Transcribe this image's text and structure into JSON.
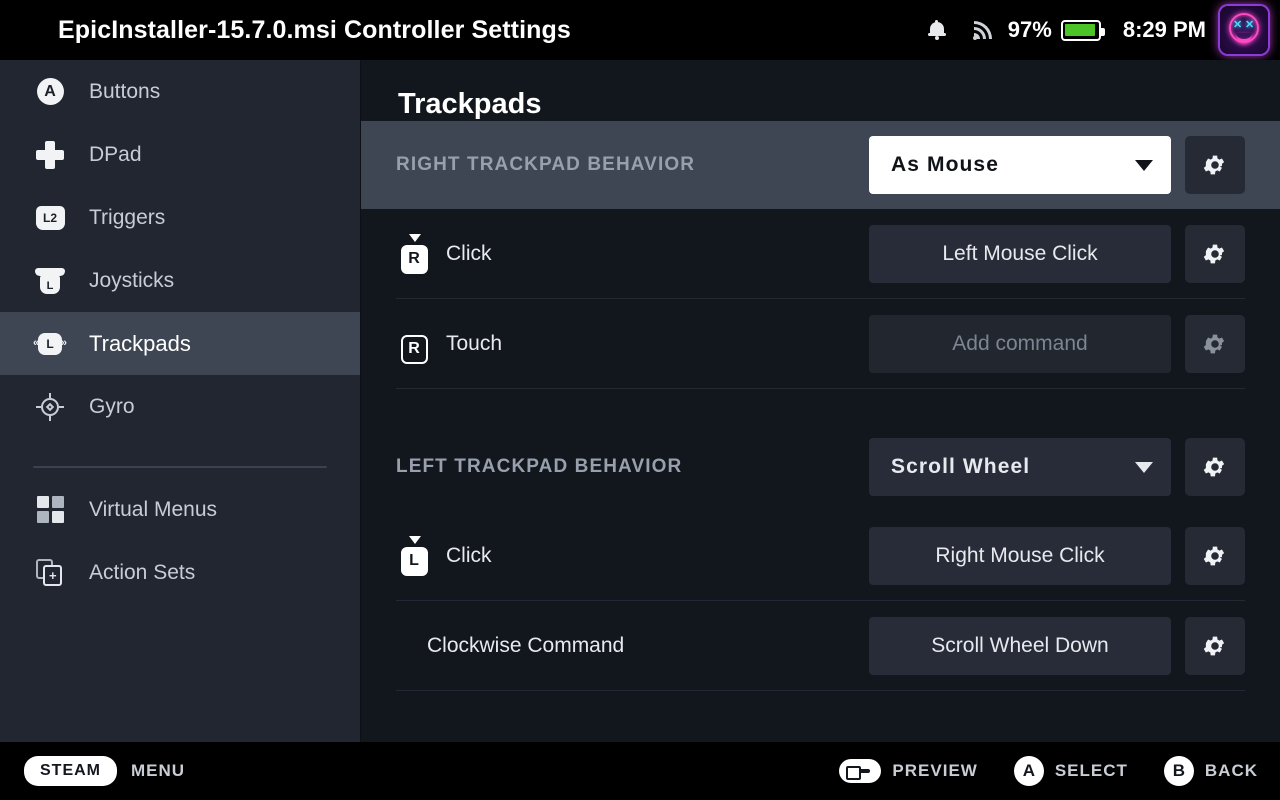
{
  "topbar": {
    "title": "EpicInstaller-15.7.0.msi Controller Settings",
    "bell_icon": "notification-bell-icon",
    "wifi_icon": "wifi-signal-icon",
    "battery_percent": "97%",
    "battery_level": 97,
    "battery_color": "#4cc326",
    "clock": "8:29 PM",
    "avatar_icon": "neon-smiley-avatar"
  },
  "sidebar": {
    "items": [
      {
        "label": "Buttons",
        "icon": "a-button-icon",
        "selected": false
      },
      {
        "label": "DPad",
        "icon": "dpad-icon",
        "selected": false
      },
      {
        "label": "Triggers",
        "icon": "l2-trigger-icon",
        "key": "L2",
        "selected": false
      },
      {
        "label": "Joysticks",
        "icon": "joystick-icon",
        "key": "L",
        "selected": false
      },
      {
        "label": "Trackpads",
        "icon": "trackpad-icon",
        "key": "L",
        "selected": true
      },
      {
        "label": "Gyro",
        "icon": "gyro-icon",
        "selected": false
      }
    ],
    "footer_items": [
      {
        "label": "Virtual Menus",
        "icon": "grid-menu-icon"
      },
      {
        "label": "Action Sets",
        "icon": "action-sets-icon"
      }
    ]
  },
  "main": {
    "page_title": "Trackpads",
    "sections": [
      {
        "header": "RIGHT TRACKPAD BEHAVIOR",
        "behavior_value": "As Mouse",
        "focused": true,
        "rows": [
          {
            "label": "Click",
            "icon": "right-trackpad-click-icon",
            "key": "R",
            "pressed": true,
            "value": "Left Mouse Click",
            "empty": false
          },
          {
            "label": "Touch",
            "icon": "right-trackpad-touch-icon",
            "key": "R",
            "pressed": false,
            "value": "Add command",
            "empty": true
          }
        ]
      },
      {
        "header": "LEFT TRACKPAD BEHAVIOR",
        "behavior_value": "Scroll Wheel",
        "focused": false,
        "rows": [
          {
            "label": "Click",
            "icon": "left-trackpad-click-icon",
            "key": "L",
            "pressed": true,
            "value": "Right Mouse Click",
            "empty": false
          },
          {
            "label": "Clockwise Command",
            "icon": null,
            "value": "Scroll Wheel Down",
            "empty": false
          }
        ]
      }
    ],
    "gear_icon": "gear-icon"
  },
  "footer": {
    "steam_label": "STEAM",
    "menu_label": "MENU",
    "hints": [
      {
        "glyph": "",
        "icon": "controller-preview-icon",
        "label": "PREVIEW"
      },
      {
        "glyph": "A",
        "icon": "a-button-icon",
        "label": "SELECT"
      },
      {
        "glyph": "B",
        "icon": "b-button-icon",
        "label": "BACK"
      }
    ]
  },
  "colors": {
    "app_bg": "#12161d",
    "sidebar_bg": "#212631",
    "selection": "#3e4653",
    "button_bg": "#272c38",
    "accent_white": "#ffffff"
  }
}
